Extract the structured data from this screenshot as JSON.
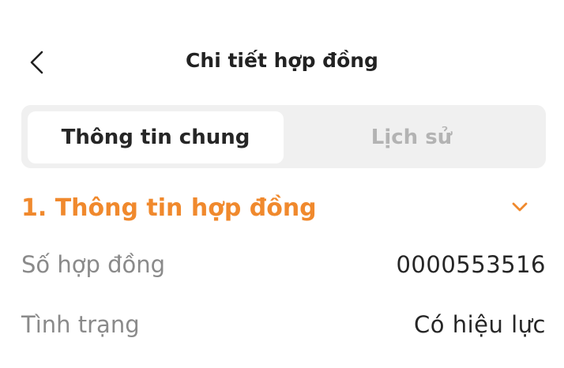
{
  "header": {
    "title": "Chi tiết hợp đồng",
    "back_icon": "chevron-left-icon"
  },
  "tabs": [
    {
      "label": "Thông tin chung",
      "active": true
    },
    {
      "label": "Lịch sử",
      "active": false
    }
  ],
  "section": {
    "title": "1. Thông tin hợp đồng",
    "expanded": true,
    "toggle_icon": "chevron-down-icon",
    "accent_color": "#f0892d"
  },
  "fields": [
    {
      "label": "Số hợp đồng",
      "value": "0000553516"
    },
    {
      "label": "Tình trạng",
      "value": "Có hiệu lực"
    }
  ]
}
